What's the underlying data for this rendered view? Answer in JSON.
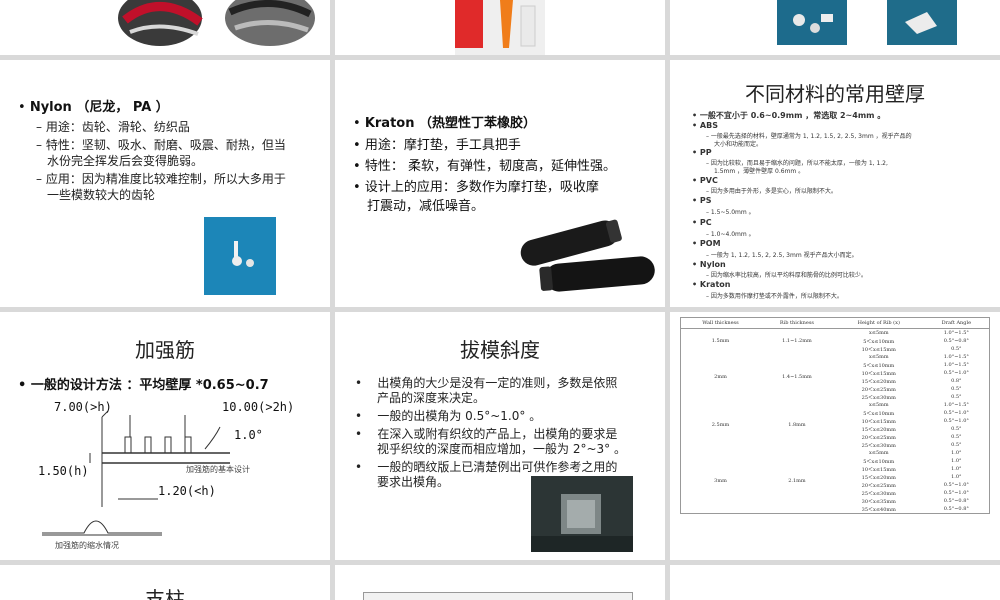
{
  "slides": {
    "nylon": {
      "heading": "Nylon （尼龙， PA ）",
      "items": [
        "用途：齿轮、滑轮、纺织品",
        "特性：坚韧、吸水、耐磨、吸震、耐热，但当",
        "水份完全挥发后会变得脆弱。",
        "应用：因为精准度比较难控制，所以大多用于",
        "一些模数较大的齿轮"
      ]
    },
    "kraton": {
      "heading": "Kraton （热塑性丁苯橡胶）",
      "items": [
        "用途：摩打垫，手工具把手",
        "特性：   柔软，有弹性，韧度高，延伸性强。",
        "设计上的应用：多数作为摩打垫，吸收摩",
        "打震动，减低噪音。"
      ]
    },
    "wall": {
      "title": "不同材料的常用壁厚",
      "lines": [
        "一般不宜小于 0.6~0.9mm ，常选取 2~4mm 。",
        "ABS",
        "一般最先选择的材料，壁厚通常为 1, 1.2, 1.5, 2, 2.5, 3mm ，视乎产品的",
        "大小和功能而定。",
        "PP",
        "因为比较软，而且易于缩水的问题，所以不能太厚，一般为 1, 1.2,",
        "1.5mm ，薄壁件壁厚 0.6mm 。",
        "PVC",
        "因为多用由于外形，多是实心，所以限制不大。",
        "PS",
        "1.5~5.0mm 。",
        "PC",
        "1.0~4.0mm 。",
        "POM",
        "一般为 1, 1.2, 1.5, 2, 2.5, 3mm 视乎产品大小而定。",
        "Nylon",
        "因为缩水率比较高，所以平均料厚和筋骨的比例可比较少。",
        "Kraton",
        "因为多数用作摩打垫或不外露件，所以限制不大。"
      ]
    },
    "rib": {
      "title": "加强筋",
      "method": "一般的设计方法 ：平均壁厚 *0.65~0.7",
      "dims": [
        "7.00(>h)",
        "10.00(>2h)",
        "1.0°",
        "1.50(h)",
        "1.20(<h)"
      ],
      "caption1": "加强筋的基本设计",
      "caption2": "加强筋的缩水情况"
    },
    "draft": {
      "title": "拔模斜度",
      "lines": [
        "出模角的大少是没有一定的准则，多数是依照",
        "产品的深度来决定。",
        "一般的出模角为 0.5°~1.0° 。",
        "在深入或附有织纹的产品上，出模角的要求是",
        "视乎织纹的深度而相应增加，一般为 2°~3° 。",
        "一般的晒纹版上已清楚例出可供作参考之用的",
        "要求出模角。"
      ]
    },
    "table": {
      "headers": [
        "Wall thickness",
        "Rib thickness",
        "Height of Rib (x)",
        "Draft Angle"
      ],
      "groups": [
        {
          "wall": "1.5mm",
          "rib": "1.1~1.2mm",
          "rows": [
            [
              "x≤5mm",
              "1.0°~1.5°"
            ],
            [
              "5＜x≤10mm",
              "0.5°~0.8°"
            ],
            [
              "10＜x≤15mm",
              "0.5°"
            ]
          ]
        },
        {
          "wall": "2mm",
          "rib": "1.4~1.5mm",
          "rows": [
            [
              "x≤5mm",
              "1.0°~1.5°"
            ],
            [
              "5＜x≤10mm",
              "1.0°~1.5°"
            ],
            [
              "10＜x≤15mm",
              "0.5°~1.0°"
            ],
            [
              "15＜x≤20mm",
              "0.8°"
            ],
            [
              "20＜x≤25mm",
              "0.5°"
            ],
            [
              "25＜x≤30mm",
              "0.5°"
            ]
          ]
        },
        {
          "wall": "2.5mm",
          "rib": "1.8mm",
          "rows": [
            [
              "x≤5mm",
              "1.0°~1.5°"
            ],
            [
              "5＜x≤10mm",
              "0.5°~1.0°"
            ],
            [
              "10＜x≤15mm",
              "0.5°~1.0°"
            ],
            [
              "15＜x≤20mm",
              "0.5°"
            ],
            [
              "20＜x≤25mm",
              "0.5°"
            ],
            [
              "25＜x≤30mm",
              "0.5°"
            ]
          ]
        },
        {
          "wall": "3mm",
          "rib": "2.1mm",
          "rows": [
            [
              "x≤5mm",
              "1.0°"
            ],
            [
              "5＜x≤10mm",
              "1.0°"
            ],
            [
              "10＜x≤15mm",
              "1.0°"
            ],
            [
              "15＜x≤20mm",
              "1.0°"
            ],
            [
              "20＜x≤25mm",
              "0.5°~1.0°"
            ],
            [
              "25＜x≤30mm",
              "0.5°~1.0°"
            ],
            [
              "30＜x≤35mm",
              "0.5°~0.8°"
            ],
            [
              "35＜x≤40mm",
              "0.5°~0.8°"
            ]
          ]
        }
      ]
    },
    "boss": {
      "title": "支柱"
    }
  }
}
